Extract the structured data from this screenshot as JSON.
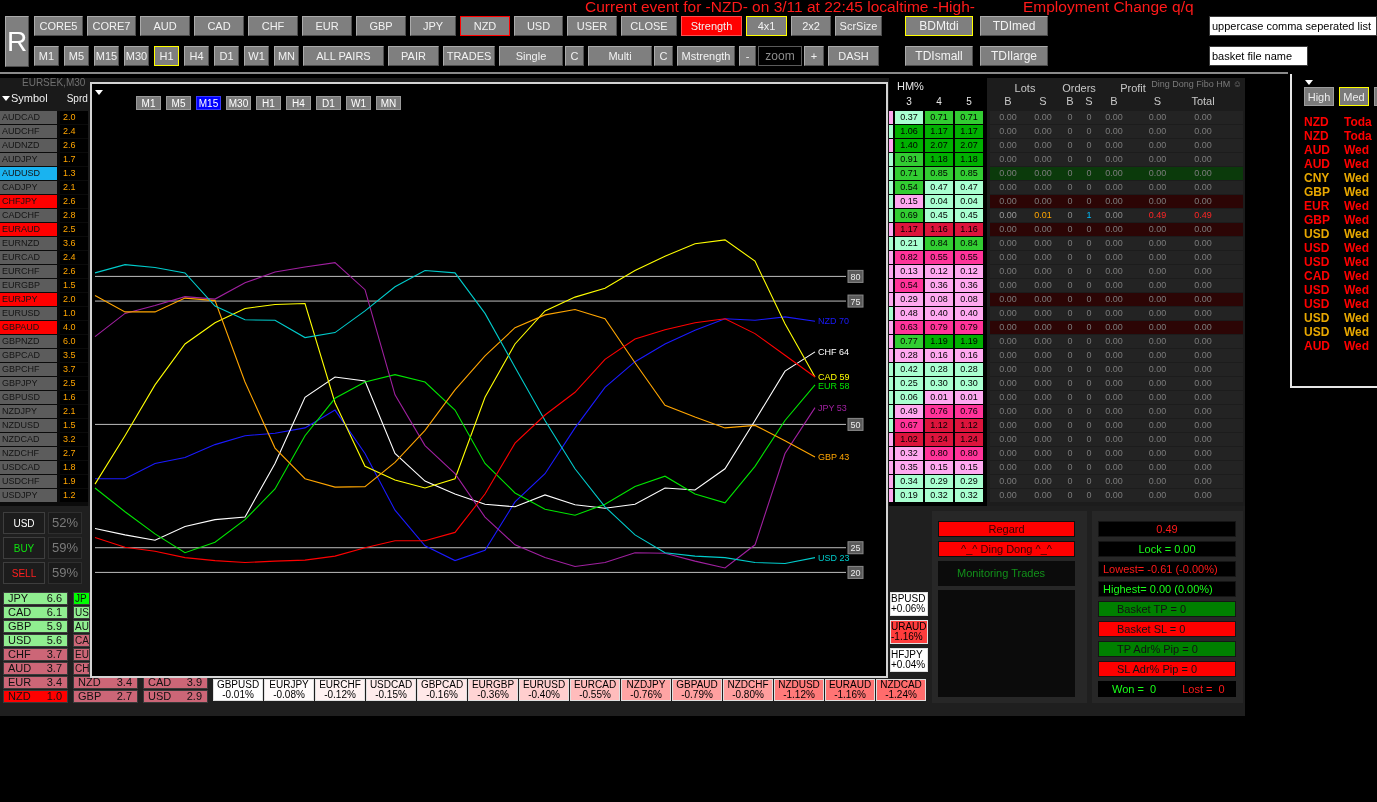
{
  "event_banner": [
    "Current event for -NZD- on 3/11 at 22:45 localtime -High-",
    "Employment Change q/q"
  ],
  "toolbar": {
    "reset_button": "R",
    "row_1": [
      {
        "label": "CORE5",
        "selected": false,
        "flagged": false,
        "active": false
      },
      {
        "label": "CORE7",
        "selected": false,
        "flagged": false,
        "active": false
      },
      {
        "label": "AUD",
        "selected": false,
        "flagged": false,
        "active": false
      },
      {
        "label": "CAD",
        "selected": false,
        "flagged": false,
        "active": false
      },
      {
        "label": "CHF",
        "selected": false,
        "flagged": false,
        "active": false
      },
      {
        "label": "EUR",
        "selected": false,
        "flagged": false,
        "active": false
      },
      {
        "label": "GBP",
        "selected": false,
        "flagged": false,
        "active": false
      },
      {
        "label": "JPY",
        "selected": false,
        "flagged": false,
        "active": false
      },
      {
        "label": "NZD",
        "selected": false,
        "flagged": true,
        "active": false
      },
      {
        "label": "USD",
        "selected": false,
        "flagged": false,
        "active": false
      },
      {
        "label": "USER",
        "selected": false,
        "flagged": false,
        "active": false
      },
      {
        "label": "CLOSE",
        "selected": false,
        "flagged": false,
        "active": false
      },
      {
        "label": "Strength",
        "selected": false,
        "flagged": false,
        "active": true
      },
      {
        "label": "4x1",
        "selected": true,
        "flagged": false,
        "active": false
      },
      {
        "label": "2x2",
        "selected": false,
        "flagged": false,
        "active": false
      },
      {
        "label": "ScrSize",
        "selected": false,
        "flagged": false,
        "active": false
      }
    ],
    "timeframes": [
      {
        "label": "M1",
        "selected": false
      },
      {
        "label": "M5",
        "selected": false
      },
      {
        "label": "M15",
        "selected": false
      },
      {
        "label": "M30",
        "selected": false
      },
      {
        "label": "H1",
        "selected": true
      },
      {
        "label": "H4",
        "selected": false
      },
      {
        "label": "D1",
        "selected": false
      },
      {
        "label": "W1",
        "selected": false
      },
      {
        "label": "MN",
        "selected": false
      }
    ],
    "row_2": [
      {
        "kind": "button",
        "label": "ALL PAIRS"
      },
      {
        "kind": "button",
        "label": "PAIR"
      },
      {
        "kind": "button",
        "label": "TRADES"
      },
      {
        "kind": "split",
        "label": "Single",
        "side_label": "C"
      },
      {
        "kind": "split",
        "label": "Multi",
        "side_label": "C"
      },
      {
        "kind": "button",
        "label": "Mstrength"
      },
      {
        "kind": "zoom",
        "minus": "-",
        "placeholder": "zoom",
        "plus": "+"
      },
      {
        "kind": "button",
        "label": "DASH"
      }
    ],
    "tdi_buttons": [
      {
        "label": "BDMtdi",
        "selected": true
      },
      {
        "label": "TDImed",
        "selected": false
      },
      {
        "label": "TDIsmall",
        "selected": false
      },
      {
        "label": "TDIlarge",
        "selected": false
      }
    ],
    "fields": [
      {
        "value": "uppercase comma seperated list"
      },
      {
        "value": "basket file name"
      }
    ]
  },
  "symbol_table": {
    "chart_caption": "EURSEK,M30",
    "columns": [
      "Symbol",
      "Sprd"
    ],
    "rows": [
      {
        "symbol": "AUDCAD",
        "spread": "2.0",
        "color": "#5c5c5c"
      },
      {
        "symbol": "AUDCHF",
        "spread": "2.4",
        "color": "#5c5c5c"
      },
      {
        "symbol": "AUDNZD",
        "spread": "2.6",
        "color": "#5c5c5c"
      },
      {
        "symbol": "AUDJPY",
        "spread": "1.7",
        "color": "#5c5c5c"
      },
      {
        "symbol": "AUDUSD",
        "spread": "1.3",
        "color": "#19b3f0"
      },
      {
        "symbol": "CADJPY",
        "spread": "2.1",
        "color": "#5c5c5c"
      },
      {
        "symbol": "CHFJPY",
        "spread": "2.6",
        "color": "#ff0000"
      },
      {
        "symbol": "CADCHF",
        "spread": "2.8",
        "color": "#5c5c5c"
      },
      {
        "symbol": "EURAUD",
        "spread": "2.5",
        "color": "#ff0000"
      },
      {
        "symbol": "EURNZD",
        "spread": "3.6",
        "color": "#5c5c5c"
      },
      {
        "symbol": "EURCAD",
        "spread": "2.4",
        "color": "#5c5c5c"
      },
      {
        "symbol": "EURCHF",
        "spread": "2.6",
        "color": "#5c5c5c"
      },
      {
        "symbol": "EURGBP",
        "spread": "1.5",
        "color": "#5c5c5c"
      },
      {
        "symbol": "EURJPY",
        "spread": "2.0",
        "color": "#ff0000"
      },
      {
        "symbol": "EURUSD",
        "spread": "1.0",
        "color": "#5c5c5c"
      },
      {
        "symbol": "GBPAUD",
        "spread": "4.0",
        "color": "#ff0000"
      },
      {
        "symbol": "GBPNZD",
        "spread": "6.0",
        "color": "#5c5c5c"
      },
      {
        "symbol": "GBPCAD",
        "spread": "3.5",
        "color": "#5c5c5c"
      },
      {
        "symbol": "GBPCHF",
        "spread": "3.7",
        "color": "#5c5c5c"
      },
      {
        "symbol": "GBPJPY",
        "spread": "2.5",
        "color": "#5c5c5c"
      },
      {
        "symbol": "GBPUSD",
        "spread": "1.6",
        "color": "#5c5c5c"
      },
      {
        "symbol": "NZDJPY",
        "spread": "2.1",
        "color": "#5c5c5c"
      },
      {
        "symbol": "NZDUSD",
        "spread": "1.5",
        "color": "#5c5c5c"
      },
      {
        "symbol": "NZDCAD",
        "spread": "3.2",
        "color": "#5c5c5c"
      },
      {
        "symbol": "NZDCHF",
        "spread": "2.7",
        "color": "#5c5c5c"
      },
      {
        "symbol": "USDCAD",
        "spread": "1.8",
        "color": "#5c5c5c"
      },
      {
        "symbol": "USDCHF",
        "spread": "1.9",
        "color": "#5c5c5c"
      },
      {
        "symbol": "USDJPY",
        "spread": "1.2",
        "color": "#5c5c5c"
      }
    ]
  },
  "chart_window": {
    "timeframes": [
      {
        "label": "M1",
        "selected": false
      },
      {
        "label": "M5",
        "selected": false
      },
      {
        "label": "M15",
        "selected": true
      },
      {
        "label": "M30",
        "selected": false
      },
      {
        "label": "H1",
        "selected": false
      },
      {
        "label": "H4",
        "selected": false
      },
      {
        "label": "D1",
        "selected": false
      },
      {
        "label": "W1",
        "selected": false
      },
      {
        "label": "MN",
        "selected": false
      }
    ],
    "chart_data": {
      "type": "line",
      "categories": [
        null,
        null,
        null,
        null,
        null,
        null,
        null,
        null,
        null,
        null,
        null,
        null,
        null,
        null,
        null,
        null,
        null,
        null,
        null,
        null,
        null,
        null,
        null,
        null,
        null
      ],
      "ylim": [
        -1,
        119
      ],
      "yticks": [
        20,
        25,
        50,
        75,
        80
      ],
      "grid": true,
      "series": [
        {
          "name": "NZD 70",
          "color": "#1a1aff",
          "values": [
            39,
            39,
            42.1,
            43.3,
            45.9,
            47.7,
            48.2,
            49.3,
            52.9,
            44.1,
            32.6,
            25.4,
            22.4,
            24.5,
            34.3,
            40,
            49.3,
            57.5,
            62.7,
            66.3,
            69.1,
            71.4,
            71.1,
            71.8,
            70.9
          ]
        },
        {
          "name": "CHF 64",
          "color": "#ffffff",
          "values": [
            28.9,
            27.6,
            26.5,
            29.3,
            30.7,
            31.2,
            42.1,
            55.5,
            59.6,
            58.8,
            44.1,
            38.5,
            35.9,
            33.8,
            33.3,
            35.7,
            33.7,
            33,
            33.8,
            37.1,
            36.7,
            41,
            50.8,
            60.8,
            64.7
          ]
        },
        {
          "name": "CAD 59",
          "color": "#ffff00",
          "values": [
            37.9,
            47.7,
            58,
            66.3,
            70.6,
            73.5,
            74.3,
            74.5,
            54.4,
            41.5,
            38.7,
            37.1,
            39,
            55.5,
            66.3,
            73,
            75.8,
            77.6,
            81.2,
            84.1,
            86.6,
            87.4,
            83.1,
            70.4,
            59.6
          ]
        },
        {
          "name": "EUR 58",
          "color": "#00e600",
          "values": [
            37.1,
            32.3,
            27.8,
            24,
            26.1,
            30.7,
            36.9,
            47.7,
            55.3,
            58.6,
            60.1,
            58.6,
            52.9,
            42.1,
            36.1,
            32.8,
            31.6,
            33.8,
            37.4,
            39.5,
            35.9,
            34.1,
            41.5,
            50.8,
            58
          ]
        },
        {
          "name": "JPY 53",
          "color": "#a020a0",
          "values": [
            67.8,
            72.5,
            74.1,
            75.9,
            75.4,
            78.7,
            80.9,
            81.9,
            82.8,
            77.3,
            56,
            45.7,
            40,
            31.2,
            25.6,
            23,
            21.2,
            22,
            24,
            23.9,
            22.3,
            20.9,
            25.6,
            44.1,
            53.4
          ]
        },
        {
          "name": "GBP 43",
          "color": "#ffa500",
          "values": [
            76.1,
            72.8,
            72.8,
            75.6,
            75.1,
            58.6,
            45.2,
            39,
            37.3,
            37.4,
            42.3,
            48.8,
            57,
            63.9,
            69.6,
            72.2,
            73.3,
            71.4,
            62.5,
            53.9,
            51.5,
            49.3,
            49.8,
            46.7,
            43.4
          ]
        },
        {
          "name": "USD 23",
          "color": "#00cccc",
          "values": [
            80.7,
            82.4,
            81.8,
            80.7,
            74,
            71.2,
            71.1,
            67.6,
            68.6,
            73,
            77.9,
            81.2,
            80.7,
            72.5,
            61.6,
            50.8,
            41,
            33.3,
            27.6,
            24,
            23.3,
            23,
            22,
            21.8,
            23
          ]
        },
        {
          "color": "#ff0000",
          "values": [
            27.1,
            25.1,
            24.3,
            23,
            22.4,
            22,
            22.3,
            22.5,
            23.3,
            25,
            26.4,
            26.4,
            28.1,
            35.9,
            46.2,
            51.9,
            56.5,
            63.2,
            67.3,
            69.2,
            70.6,
            71.4,
            68.4,
            64,
            59.6
          ]
        }
      ]
    }
  },
  "heatmap": {
    "title": "HM%",
    "columns": [
      "3",
      "4",
      "5"
    ],
    "rows": [
      {
        "column_2": {
          "color": "#ffa8f0"
        },
        "cells": [
          {
            "value": "0.37",
            "color": "#a8ffd0"
          },
          {
            "value": "0.71",
            "color": "#32cd32"
          },
          {
            "value": "0.71",
            "color": "#32cd32"
          }
        ]
      },
      {
        "column_2": {
          "color": "#a8ffd0"
        },
        "cells": [
          {
            "value": "1.06",
            "color": "#00b000"
          },
          {
            "value": "1.17",
            "color": "#00b000"
          },
          {
            "value": "1.17",
            "color": "#00b000"
          }
        ]
      },
      {
        "column_2": {
          "color": "#ffa8f0"
        },
        "cells": [
          {
            "value": "1.40",
            "color": "#00b000"
          },
          {
            "value": "2.07",
            "color": "#00b000"
          },
          {
            "value": "2.07",
            "color": "#00b000"
          }
        ]
      },
      {
        "column_2": {
          "color": "#a8ffd0"
        },
        "cells": [
          {
            "value": "0.91",
            "color": "#32cd32"
          },
          {
            "value": "1.18",
            "color": "#00b000"
          },
          {
            "value": "1.18",
            "color": "#00b000"
          }
        ]
      },
      {
        "column_2": {
          "color": "#a8ffd0"
        },
        "cells": [
          {
            "value": "0.71",
            "color": "#32cd32"
          },
          {
            "value": "0.85",
            "color": "#32cd32"
          },
          {
            "value": "0.85",
            "color": "#32cd32"
          }
        ]
      },
      {
        "column_2": {
          "color": "#a8ffd0"
        },
        "cells": [
          {
            "value": "0.54",
            "color": "#32cd32"
          },
          {
            "value": "0.47",
            "color": "#a8ffd0"
          },
          {
            "value": "0.47",
            "color": "#a8ffd0"
          }
        ]
      },
      {
        "column_2": {
          "color": "#a8ffd0"
        },
        "cells": [
          {
            "value": "0.15",
            "color": "#ffa8f0"
          },
          {
            "value": "0.04",
            "color": "#a8ffd0"
          },
          {
            "value": "0.04",
            "color": "#a8ffd0"
          }
        ]
      },
      {
        "column_2": {
          "color": "#a8ffd0"
        },
        "cells": [
          {
            "value": "0.69",
            "color": "#32cd32"
          },
          {
            "value": "0.45",
            "color": "#a8ffd0"
          },
          {
            "value": "0.45",
            "color": "#a8ffd0"
          }
        ]
      },
      {
        "column_2": {
          "color": "#ffa8f0"
        },
        "cells": [
          {
            "value": "1.17",
            "color": "#dc143c"
          },
          {
            "value": "1.16",
            "color": "#dc143c"
          },
          {
            "value": "1.16",
            "color": "#dc143c"
          }
        ]
      },
      {
        "column_2": {
          "color": "#a8ffd0"
        },
        "cells": [
          {
            "value": "0.21",
            "color": "#a8ffd0"
          },
          {
            "value": "0.84",
            "color": "#32cd32"
          },
          {
            "value": "0.84",
            "color": "#32cd32"
          }
        ]
      },
      {
        "column_2": {
          "color": "#ffa8f0"
        },
        "cells": [
          {
            "value": "0.82",
            "color": "#ff3399"
          },
          {
            "value": "0.55",
            "color": "#ff3399"
          },
          {
            "value": "0.55",
            "color": "#ff3399"
          }
        ]
      },
      {
        "column_2": {
          "color": "#ffa8f0"
        },
        "cells": [
          {
            "value": "0.13",
            "color": "#ffa8f0"
          },
          {
            "value": "0.12",
            "color": "#ffa8f0"
          },
          {
            "value": "0.12",
            "color": "#ffa8f0"
          }
        ]
      },
      {
        "column_2": {
          "color": "#ffa8f0"
        },
        "cells": [
          {
            "value": "0.54",
            "color": "#ff3399"
          },
          {
            "value": "0.36",
            "color": "#ffa8f0"
          },
          {
            "value": "0.36",
            "color": "#ffa8f0"
          }
        ]
      },
      {
        "column_2": {
          "color": "#ffa8f0"
        },
        "cells": [
          {
            "value": "0.29",
            "color": "#ffa8f0"
          },
          {
            "value": "0.08",
            "color": "#ffa8f0"
          },
          {
            "value": "0.08",
            "color": "#ffa8f0"
          }
        ]
      },
      {
        "column_2": {
          "color": "#a8ffd0"
        },
        "cells": [
          {
            "value": "0.48",
            "color": "#ffa8f0"
          },
          {
            "value": "0.40",
            "color": "#ffa8f0"
          },
          {
            "value": "0.40",
            "color": "#ffa8f0"
          }
        ]
      },
      {
        "column_2": {
          "color": "#ffa8f0"
        },
        "cells": [
          {
            "value": "0.63",
            "color": "#ff3399"
          },
          {
            "value": "0.79",
            "color": "#ff3399"
          },
          {
            "value": "0.79",
            "color": "#ff3399"
          }
        ]
      },
      {
        "column_2": {
          "color": "#ffa8f0"
        },
        "cells": [
          {
            "value": "0.77",
            "color": "#32cd32"
          },
          {
            "value": "1.19",
            "color": "#00b000"
          },
          {
            "value": "1.19",
            "color": "#00b000"
          }
        ]
      },
      {
        "column_2": {
          "color": "#ffa8f0"
        },
        "cells": [
          {
            "value": "0.28",
            "color": "#ffa8f0"
          },
          {
            "value": "0.16",
            "color": "#ffa8f0"
          },
          {
            "value": "0.16",
            "color": "#ffa8f0"
          }
        ]
      },
      {
        "column_2": {
          "color": "#a8ffd0"
        },
        "cells": [
          {
            "value": "0.42",
            "color": "#a8ffd0"
          },
          {
            "value": "0.28",
            "color": "#a8ffd0"
          },
          {
            "value": "0.28",
            "color": "#a8ffd0"
          }
        ]
      },
      {
        "column_2": {
          "color": "#a8ffd0"
        },
        "cells": [
          {
            "value": "0.25",
            "color": "#a8ffd0"
          },
          {
            "value": "0.30",
            "color": "#a8ffd0"
          },
          {
            "value": "0.30",
            "color": "#a8ffd0"
          }
        ]
      },
      {
        "column_2": {
          "color": "#a8ffd0"
        },
        "cells": [
          {
            "value": "0.06",
            "color": "#a8ffd0"
          },
          {
            "value": "0.01",
            "color": "#ffa8f0"
          },
          {
            "value": "0.01",
            "color": "#ffa8f0"
          }
        ]
      },
      {
        "column_2": {
          "color": "#a8ffd0"
        },
        "cells": [
          {
            "value": "0.49",
            "color": "#ffa8f0"
          },
          {
            "value": "0.76",
            "color": "#ff3399"
          },
          {
            "value": "0.76",
            "color": "#ff3399"
          }
        ]
      },
      {
        "column_2": {
          "color": "#a8ffd0"
        },
        "cells": [
          {
            "value": "0.67",
            "color": "#ff3399"
          },
          {
            "value": "1.12",
            "color": "#dc143c"
          },
          {
            "value": "1.12",
            "color": "#dc143c"
          }
        ]
      },
      {
        "column_2": {
          "color": "#ffa8f0"
        },
        "cells": [
          {
            "value": "1.02",
            "color": "#dc143c"
          },
          {
            "value": "1.24",
            "color": "#dc143c"
          },
          {
            "value": "1.24",
            "color": "#dc143c"
          }
        ]
      },
      {
        "column_2": {
          "color": "#ffa8f0"
        },
        "cells": [
          {
            "value": "0.32",
            "color": "#ffa8f0"
          },
          {
            "value": "0.80",
            "color": "#ff3399"
          },
          {
            "value": "0.80",
            "color": "#ff3399"
          }
        ]
      },
      {
        "column_2": {
          "color": "#ffa8f0"
        },
        "cells": [
          {
            "value": "0.35",
            "color": "#ffa8f0"
          },
          {
            "value": "0.15",
            "color": "#ffa8f0"
          },
          {
            "value": "0.15",
            "color": "#ffa8f0"
          }
        ]
      },
      {
        "column_2": {
          "color": "#ffa8f0"
        },
        "cells": [
          {
            "value": "0.34",
            "color": "#a8ffd0"
          },
          {
            "value": "0.29",
            "color": "#a8ffd0"
          },
          {
            "value": "0.29",
            "color": "#a8ffd0"
          }
        ]
      },
      {
        "column_2": {
          "color": "#ffa8f0"
        },
        "cells": [
          {
            "value": "0.19",
            "color": "#a8ffd0"
          },
          {
            "value": "0.32",
            "color": "#a8ffd0"
          },
          {
            "value": "0.32",
            "color": "#a8ffd0"
          }
        ]
      }
    ]
  },
  "trades_table": {
    "indicator_name": "Ding Dong Fibo HM ☺",
    "groups": [
      "Lots",
      "Orders",
      "Profit"
    ],
    "columns": [
      "B",
      "S",
      "B",
      "S",
      "B",
      "S",
      "Total"
    ],
    "rows": [
      {
        "color": "#232323",
        "open": false,
        "values": [
          "0.00",
          "0.00",
          "0",
          "0",
          "0.00",
          "0.00",
          "0.00"
        ]
      },
      {
        "color": "#232323",
        "open": false,
        "values": [
          "0.00",
          "0.00",
          "0",
          "0",
          "0.00",
          "0.00",
          "0.00"
        ]
      },
      {
        "color": "#232323",
        "open": false,
        "values": [
          "0.00",
          "0.00",
          "0",
          "0",
          "0.00",
          "0.00",
          "0.00"
        ]
      },
      {
        "color": "#232323",
        "open": false,
        "values": [
          "0.00",
          "0.00",
          "0",
          "0",
          "0.00",
          "0.00",
          "0.00"
        ]
      },
      {
        "color": "#0b3a0b",
        "open": false,
        "values": [
          "0.00",
          "0.00",
          "0",
          "0",
          "0.00",
          "0.00",
          "0.00"
        ]
      },
      {
        "color": "#232323",
        "open": false,
        "values": [
          "0.00",
          "0.00",
          "0",
          "0",
          "0.00",
          "0.00",
          "0.00"
        ]
      },
      {
        "color": "#2c0505",
        "open": false,
        "values": [
          "0.00",
          "0.00",
          "0",
          "0",
          "0.00",
          "0.00",
          "0.00"
        ]
      },
      {
        "color": "#232323",
        "open": true,
        "values": [
          "0.00",
          "0.01",
          "0",
          "1",
          "0.00",
          "0.49",
          "0.49"
        ]
      },
      {
        "color": "#2c0505",
        "open": false,
        "values": [
          "0.00",
          "0.00",
          "0",
          "0",
          "0.00",
          "0.00",
          "0.00"
        ]
      },
      {
        "color": "#232323",
        "open": false,
        "values": [
          "0.00",
          "0.00",
          "0",
          "0",
          "0.00",
          "0.00",
          "0.00"
        ]
      },
      {
        "color": "#232323",
        "open": false,
        "values": [
          "0.00",
          "0.00",
          "0",
          "0",
          "0.00",
          "0.00",
          "0.00"
        ]
      },
      {
        "color": "#232323",
        "open": false,
        "values": [
          "0.00",
          "0.00",
          "0",
          "0",
          "0.00",
          "0.00",
          "0.00"
        ]
      },
      {
        "color": "#232323",
        "open": false,
        "values": [
          "0.00",
          "0.00",
          "0",
          "0",
          "0.00",
          "0.00",
          "0.00"
        ]
      },
      {
        "color": "#2c0505",
        "open": false,
        "values": [
          "0.00",
          "0.00",
          "0",
          "0",
          "0.00",
          "0.00",
          "0.00"
        ]
      },
      {
        "color": "#232323",
        "open": false,
        "values": [
          "0.00",
          "0.00",
          "0",
          "0",
          "0.00",
          "0.00",
          "0.00"
        ]
      },
      {
        "color": "#2c0505",
        "open": false,
        "values": [
          "0.00",
          "0.00",
          "0",
          "0",
          "0.00",
          "0.00",
          "0.00"
        ]
      },
      {
        "color": "#232323",
        "open": false,
        "values": [
          "0.00",
          "0.00",
          "0",
          "0",
          "0.00",
          "0.00",
          "0.00"
        ]
      },
      {
        "color": "#232323",
        "open": false,
        "values": [
          "0.00",
          "0.00",
          "0",
          "0",
          "0.00",
          "0.00",
          "0.00"
        ]
      },
      {
        "color": "#232323",
        "open": false,
        "values": [
          "0.00",
          "0.00",
          "0",
          "0",
          "0.00",
          "0.00",
          "0.00"
        ]
      },
      {
        "color": "#232323",
        "open": false,
        "values": [
          "0.00",
          "0.00",
          "0",
          "0",
          "0.00",
          "0.00",
          "0.00"
        ]
      },
      {
        "color": "#232323",
        "open": false,
        "values": [
          "0.00",
          "0.00",
          "0",
          "0",
          "0.00",
          "0.00",
          "0.00"
        ]
      },
      {
        "color": "#232323",
        "open": false,
        "values": [
          "0.00",
          "0.00",
          "0",
          "0",
          "0.00",
          "0.00",
          "0.00"
        ]
      },
      {
        "color": "#232323",
        "open": false,
        "values": [
          "0.00",
          "0.00",
          "0",
          "0",
          "0.00",
          "0.00",
          "0.00"
        ]
      },
      {
        "color": "#232323",
        "open": false,
        "values": [
          "0.00",
          "0.00",
          "0",
          "0",
          "0.00",
          "0.00",
          "0.00"
        ]
      },
      {
        "color": "#232323",
        "open": false,
        "values": [
          "0.00",
          "0.00",
          "0",
          "0",
          "0.00",
          "0.00",
          "0.00"
        ]
      },
      {
        "color": "#232323",
        "open": false,
        "values": [
          "0.00",
          "0.00",
          "0",
          "0",
          "0.00",
          "0.00",
          "0.00"
        ]
      },
      {
        "color": "#232323",
        "open": false,
        "values": [
          "0.00",
          "0.00",
          "0",
          "0",
          "0.00",
          "0.00",
          "0.00"
        ]
      },
      {
        "color": "#232323",
        "open": false,
        "values": [
          "0.00",
          "0.00",
          "0",
          "0",
          "0.00",
          "0.00",
          "0.00"
        ]
      }
    ]
  },
  "events_panel": {
    "filters": [
      {
        "label": "High",
        "selected": false
      },
      {
        "label": "Med",
        "selected": true
      },
      {
        "selected": false
      }
    ],
    "events": [
      {
        "currency": "NZD",
        "day": "Toda",
        "color": "#ff0000"
      },
      {
        "currency": "NZD",
        "day": "Toda",
        "color": "#ff0000"
      },
      {
        "currency": "AUD",
        "day": "Wed",
        "color": "#ff0000"
      },
      {
        "currency": "AUD",
        "day": "Wed",
        "color": "#ff0000"
      },
      {
        "currency": "CNY",
        "day": "Wed",
        "color": "#e8a800"
      },
      {
        "currency": "GBP",
        "day": "Wed",
        "color": "#e8a800"
      },
      {
        "currency": "EUR",
        "day": "Wed",
        "color": "#ff0000"
      },
      {
        "currency": "GBP",
        "day": "Wed",
        "color": "#ff0000"
      },
      {
        "currency": "USD",
        "day": "Wed",
        "color": "#e8a800"
      },
      {
        "currency": "USD",
        "day": "Wed",
        "color": "#ff0000"
      },
      {
        "currency": "USD",
        "day": "Wed",
        "color": "#ff0000"
      },
      {
        "currency": "CAD",
        "day": "Wed",
        "color": "#ff0000"
      },
      {
        "currency": "USD",
        "day": "Wed",
        "color": "#ff0000"
      },
      {
        "currency": "USD",
        "day": "Wed",
        "color": "#ff0000"
      },
      {
        "currency": "USD",
        "day": "Wed",
        "color": "#e8a800"
      },
      {
        "currency": "USD",
        "day": "Wed",
        "color": "#e8a800"
      },
      {
        "currency": "AUD",
        "day": "Wed",
        "color": "#ff0000"
      }
    ]
  },
  "trade_buttons": [
    {
      "kind": "currency",
      "label": "USD",
      "percent": "52%"
    },
    {
      "kind": "buy",
      "label": "BUY",
      "percent": "59%"
    },
    {
      "kind": "sell",
      "label": "SELL",
      "percent": "59%"
    }
  ],
  "strength_columns": [
    {
      "items": [
        {
          "currency": "JPY",
          "value": "6.6",
          "color": "#90ee90"
        },
        {
          "currency": "CAD",
          "value": "6.1",
          "color": "#90ee90"
        },
        {
          "currency": "GBP",
          "value": "5.9",
          "color": "#90ee90"
        },
        {
          "currency": "USD",
          "value": "5.6",
          "color": "#90ee90"
        },
        {
          "currency": "CHF",
          "value": "3.7",
          "color": "#cc6677"
        },
        {
          "currency": "AUD",
          "value": "3.7",
          "color": "#cc6677"
        },
        {
          "currency": "EUR",
          "value": "3.4",
          "color": "#cc6677"
        },
        {
          "currency": "NZD",
          "value": "1.0",
          "color": "#ff0000"
        }
      ]
    },
    {
      "items": [
        {
          "currency": "JP",
          "color": "#00ff00"
        },
        {
          "currency": "US",
          "color": "#90ee90"
        },
        {
          "currency": "AU",
          "color": "#90ee90"
        },
        {
          "currency": "CA",
          "color": "#cc6677"
        },
        {
          "currency": "EU",
          "color": "#cc6677"
        },
        {
          "currency": "CH",
          "color": "#cc6677"
        },
        {
          "currency": "NZD",
          "value": "3.4",
          "color": "#cc6677"
        },
        {
          "currency": "GBP",
          "value": "2.7",
          "color": "#cc6677"
        }
      ]
    },
    {
      "items": [
        {
          "currency": "CAD",
          "value": "3.9",
          "color": "#cc6677"
        },
        {
          "currency": "USD",
          "value": "2.9",
          "color": "#cc6677"
        }
      ]
    }
  ],
  "side_tiles": [
    {
      "pair": "BPUSD",
      "change": "+0.06%",
      "color": "#ffffff"
    },
    {
      "pair": "URAUD",
      "change": "-1.16%",
      "color": "#ff3c3c"
    },
    {
      "pair": "HFJPY",
      "change": "+0.04%",
      "color": "#ffffff"
    }
  ],
  "pair_tiles": [
    {
      "pair": "GBPUSD",
      "change": "-0.01%",
      "color": "#ffffff"
    },
    {
      "pair": "EURJPY",
      "change": "-0.08%",
      "color": "#fffafa"
    },
    {
      "pair": "EURCHF",
      "change": "-0.12%",
      "color": "#fff2f2"
    },
    {
      "pair": "USDCAD",
      "change": "-0.15%",
      "color": "#ffecec"
    },
    {
      "pair": "GBPCAD",
      "change": "-0.16%",
      "color": "#ffe8e8"
    },
    {
      "pair": "EURGBP",
      "change": "-0.36%",
      "color": "#ffd4d4"
    },
    {
      "pair": "EURUSD",
      "change": "-0.40%",
      "color": "#ffcece"
    },
    {
      "pair": "EURCAD",
      "change": "-0.55%",
      "color": "#ffbcbc"
    },
    {
      "pair": "NZDJPY",
      "change": "-0.76%",
      "color": "#ffa4a4"
    },
    {
      "pair": "GBPAUD",
      "change": "-0.79%",
      "color": "#ffa0a0"
    },
    {
      "pair": "NZDCHF",
      "change": "-0.80%",
      "color": "#ff9e9e"
    },
    {
      "pair": "NZDUSD",
      "change": "-1.12%",
      "color": "#ff7a7a"
    },
    {
      "pair": "EURAUD",
      "change": "-1.16%",
      "color": "#ff7474"
    },
    {
      "pair": "NZDCAD",
      "change": "-1.24%",
      "color": "#ff6c6c"
    }
  ],
  "alerts_panel": {
    "buttons": [
      "Regard",
      "^_^ Ding Dong ^_^"
    ],
    "status": "Monitoring Trades"
  },
  "stats_panel": {
    "items": [
      {
        "kind": "total",
        "text": "0.49"
      },
      {
        "kind": "lock",
        "text": "Lock = 0.00"
      },
      {
        "kind": "lowest",
        "text": "Lowest= -0.61 (-0.00%)"
      },
      {
        "kind": "highest",
        "text": "Highest= 0.00 (0.00%)"
      },
      {
        "kind": "target",
        "text": "Basket TP = 0"
      },
      {
        "kind": "stop",
        "text": "Basket SL = 0"
      },
      {
        "kind": "target",
        "text": "TP Adr% Pip = 0"
      },
      {
        "kind": "stop",
        "text": "SL Adr% Pip = 0"
      }
    ],
    "won": "Won =  0",
    "lost": "Lost =  0"
  }
}
